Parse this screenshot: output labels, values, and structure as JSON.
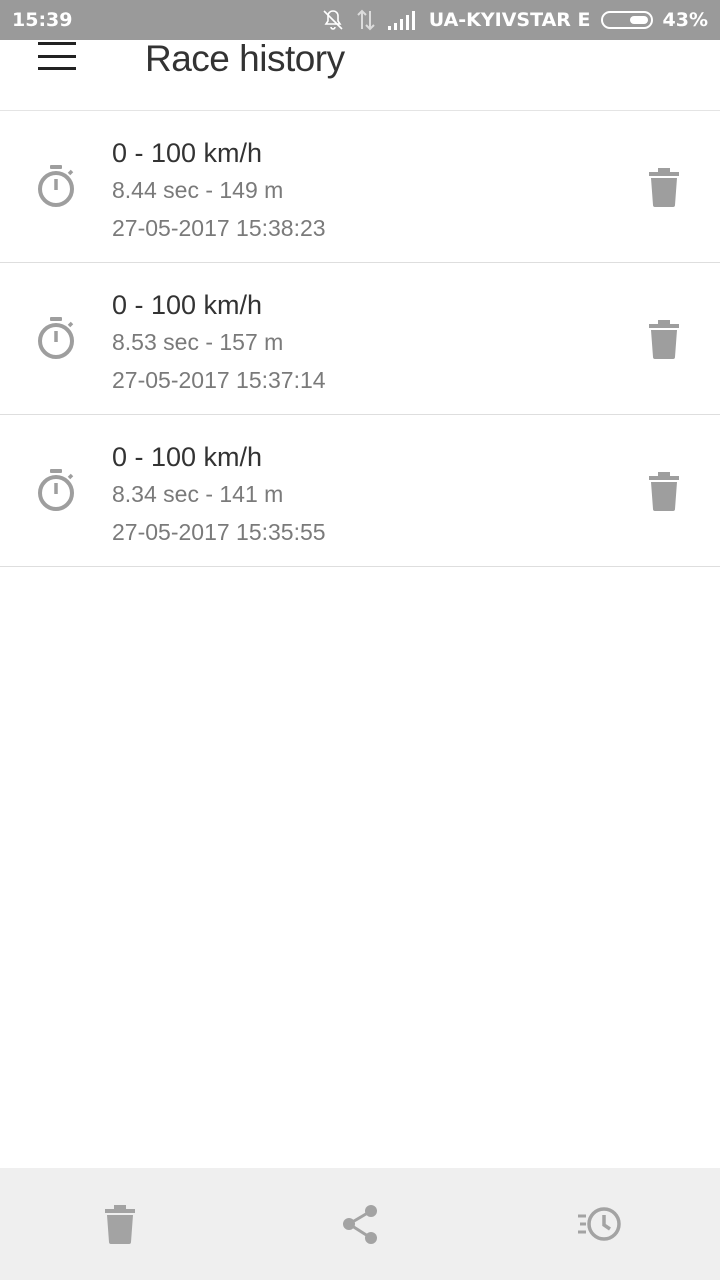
{
  "status_bar": {
    "time": "15:39",
    "carrier": "UA-KYIVSTAR E",
    "battery": "43%",
    "battery_level": 0.43
  },
  "app_bar": {
    "title": "Race history",
    "menu_icon": "hamburger-menu-icon"
  },
  "races": [
    {
      "title": "0 - 100 km/h",
      "stats": "8.44 sec - 149 m",
      "date": "27-05-2017 15:38:23"
    },
    {
      "title": "0 - 100 km/h",
      "stats": "8.53 sec - 157 m",
      "date": "27-05-2017 15:37:14"
    },
    {
      "title": "0 - 100 km/h",
      "stats": "8.34 sec - 141 m",
      "date": "27-05-2017 15:35:55"
    }
  ],
  "bottom_bar": {
    "buttons": [
      "delete-all-icon",
      "share-icon",
      "history-icon"
    ]
  },
  "colors": {
    "status_bar_bg": "#9a9a9a",
    "icon_gray": "#9e9e9e",
    "bottom_bar_bg": "#efefef"
  }
}
